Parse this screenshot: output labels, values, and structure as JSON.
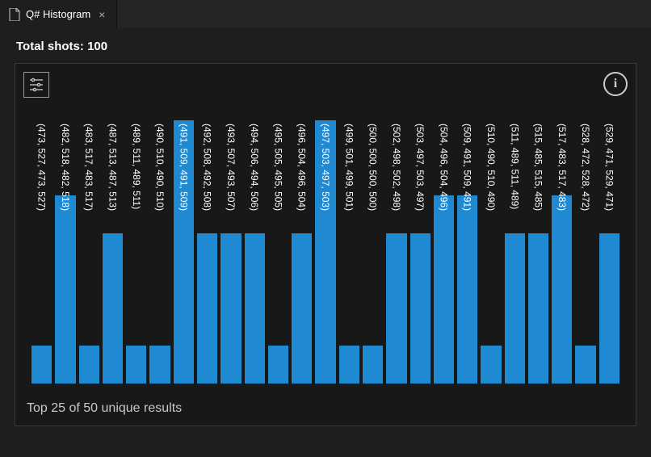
{
  "tab": {
    "title": "Q# Histogram",
    "icon": "file-icon",
    "close": "×"
  },
  "status": {
    "label": "Total shots:",
    "value": "100"
  },
  "panel": {
    "settings_icon": "settings-icon",
    "info_label": "i",
    "footer": "Top 25 of 50 unique results"
  },
  "chart_data": {
    "type": "bar",
    "title": "",
    "xlabel": "",
    "ylabel": "",
    "ylim": [
      0,
      7
    ],
    "categories": [
      "(473, 527, 473, 527)",
      "(482, 518, 482, 518)",
      "(483, 517, 483, 517)",
      "(487, 513, 487, 513)",
      "(489, 511, 489, 511)",
      "(490, 510, 490, 510)",
      "(491, 509, 491, 509)",
      "(492, 508, 492, 508)",
      "(493, 507, 493, 507)",
      "(494, 506, 494, 506)",
      "(495, 505, 495, 505)",
      "(496, 504, 496, 504)",
      "(497, 503, 497, 503)",
      "(499, 501, 499, 501)",
      "(500, 500, 500, 500)",
      "(502, 498, 502, 498)",
      "(503, 497, 503, 497)",
      "(504, 496, 504, 496)",
      "(509, 491, 509, 491)",
      "(510, 490, 510, 490)",
      "(511, 489, 511, 489)",
      "(515, 485, 515, 485)",
      "(517, 483, 517, 483)",
      "(528, 472, 528, 472)",
      "(529, 471, 529, 471)"
    ],
    "values": [
      1,
      5,
      1,
      4,
      1,
      1,
      7,
      4,
      4,
      4,
      1,
      4,
      7,
      1,
      1,
      4,
      4,
      5,
      5,
      1,
      4,
      4,
      5,
      1,
      4
    ]
  }
}
